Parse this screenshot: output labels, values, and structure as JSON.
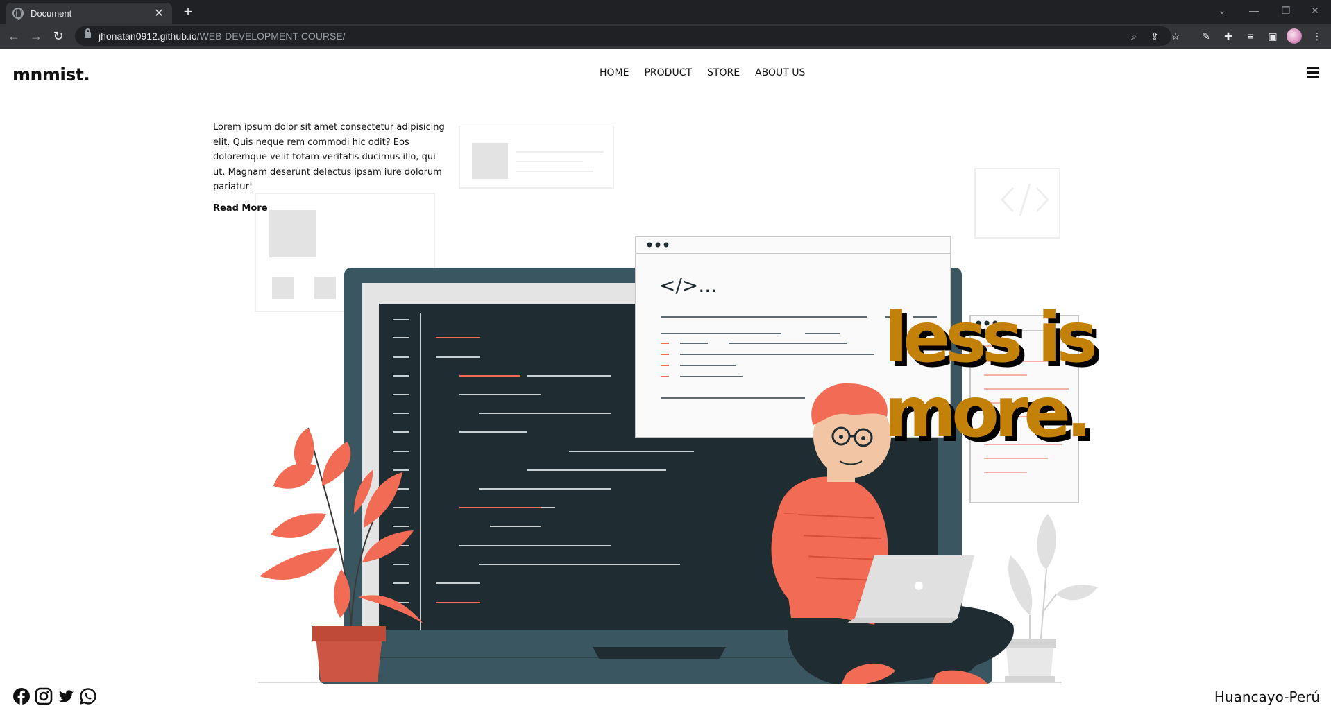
{
  "browser": {
    "tab_title": "Document",
    "tab_close": "✕",
    "new_tab": "+",
    "url_host": "jhonatan0912.github.io",
    "url_path": "/WEB-DEVELOPMENT-COURSE/",
    "back": "←",
    "forward": "→",
    "reload": "↻"
  },
  "site": {
    "logo": "mnmist.",
    "nav": [
      "HOME",
      "PRODUCT",
      "STORE",
      "ABOUT US"
    ],
    "intro_text": "Lorem ipsum dolor sit amet consectetur adipisicing elit. Quis neque rem commodi hic odit? Eos doloremque velit totam veritatis ducimus illo, qui ut. Magnam deserunt delectus ipsam iure dolorum pariatur!",
    "read_more": "Read More",
    "tagline_line1": "less is",
    "tagline_line2": "more.",
    "code_snippet": "</>...",
    "location": "Huancayo-Perú"
  },
  "icons": {
    "social": [
      "facebook-icon",
      "instagram-icon",
      "twitter-icon",
      "whatsapp-icon"
    ]
  },
  "colors": {
    "accent_gold": "#c4810a",
    "coral": "#f26b54",
    "dark_slate": "#1f2d33"
  }
}
